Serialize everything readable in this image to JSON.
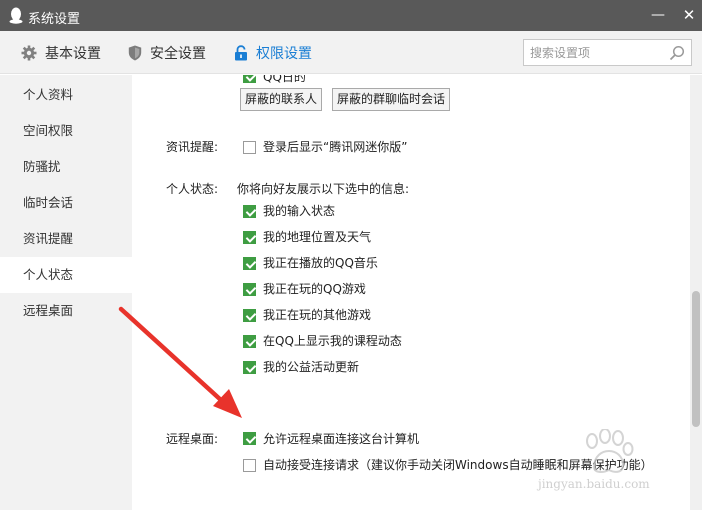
{
  "window": {
    "title": "系统设置",
    "minimize": "—",
    "close": "✕"
  },
  "nav": {
    "tabs": [
      "基本设置",
      "安全设置",
      "权限设置"
    ]
  },
  "search": {
    "placeholder": "搜索设置项"
  },
  "sidebar": {
    "items": [
      "个人资料",
      "空间权限",
      "防骚扰",
      "临时会话",
      "资讯提醒",
      "个人状态",
      "远程桌面"
    ],
    "active_index": 5
  },
  "content": {
    "partial_option": "QQ日的",
    "buttons": [
      "屏蔽的联系人",
      "屏蔽的群聊临时会话"
    ],
    "news": {
      "label": "资讯提醒:",
      "option": "登录后显示“腾讯网迷你版”",
      "checked": false
    },
    "status": {
      "label": "个人状态:",
      "intro": "你将向好友展示以下选中的信息:",
      "options": [
        {
          "text": "我的输入状态",
          "checked": true
        },
        {
          "text": "我的地理位置及天气",
          "checked": true
        },
        {
          "text": "我正在播放的QQ音乐",
          "checked": true
        },
        {
          "text": "我正在玩的QQ游戏",
          "checked": true
        },
        {
          "text": "我正在玩的其他游戏",
          "checked": true
        },
        {
          "text": "在QQ上显示我的课程动态",
          "checked": true
        },
        {
          "text": "我的公益活动更新",
          "checked": true
        }
      ]
    },
    "remote": {
      "label": "远程桌面:",
      "options": [
        {
          "text": "允许远程桌面连接这台计算机",
          "checked": true
        },
        {
          "text": "自动接受连接请求（建议你手动关闭Windows自动睡眠和屏幕保护功能）",
          "checked": false
        }
      ]
    }
  },
  "watermark": {
    "url": "jingyan.baidu.com"
  },
  "colors": {
    "titlebar": "#595959",
    "accent": "#1a7ed4",
    "check": "#3e9d42",
    "arrow": "#e8332b"
  }
}
